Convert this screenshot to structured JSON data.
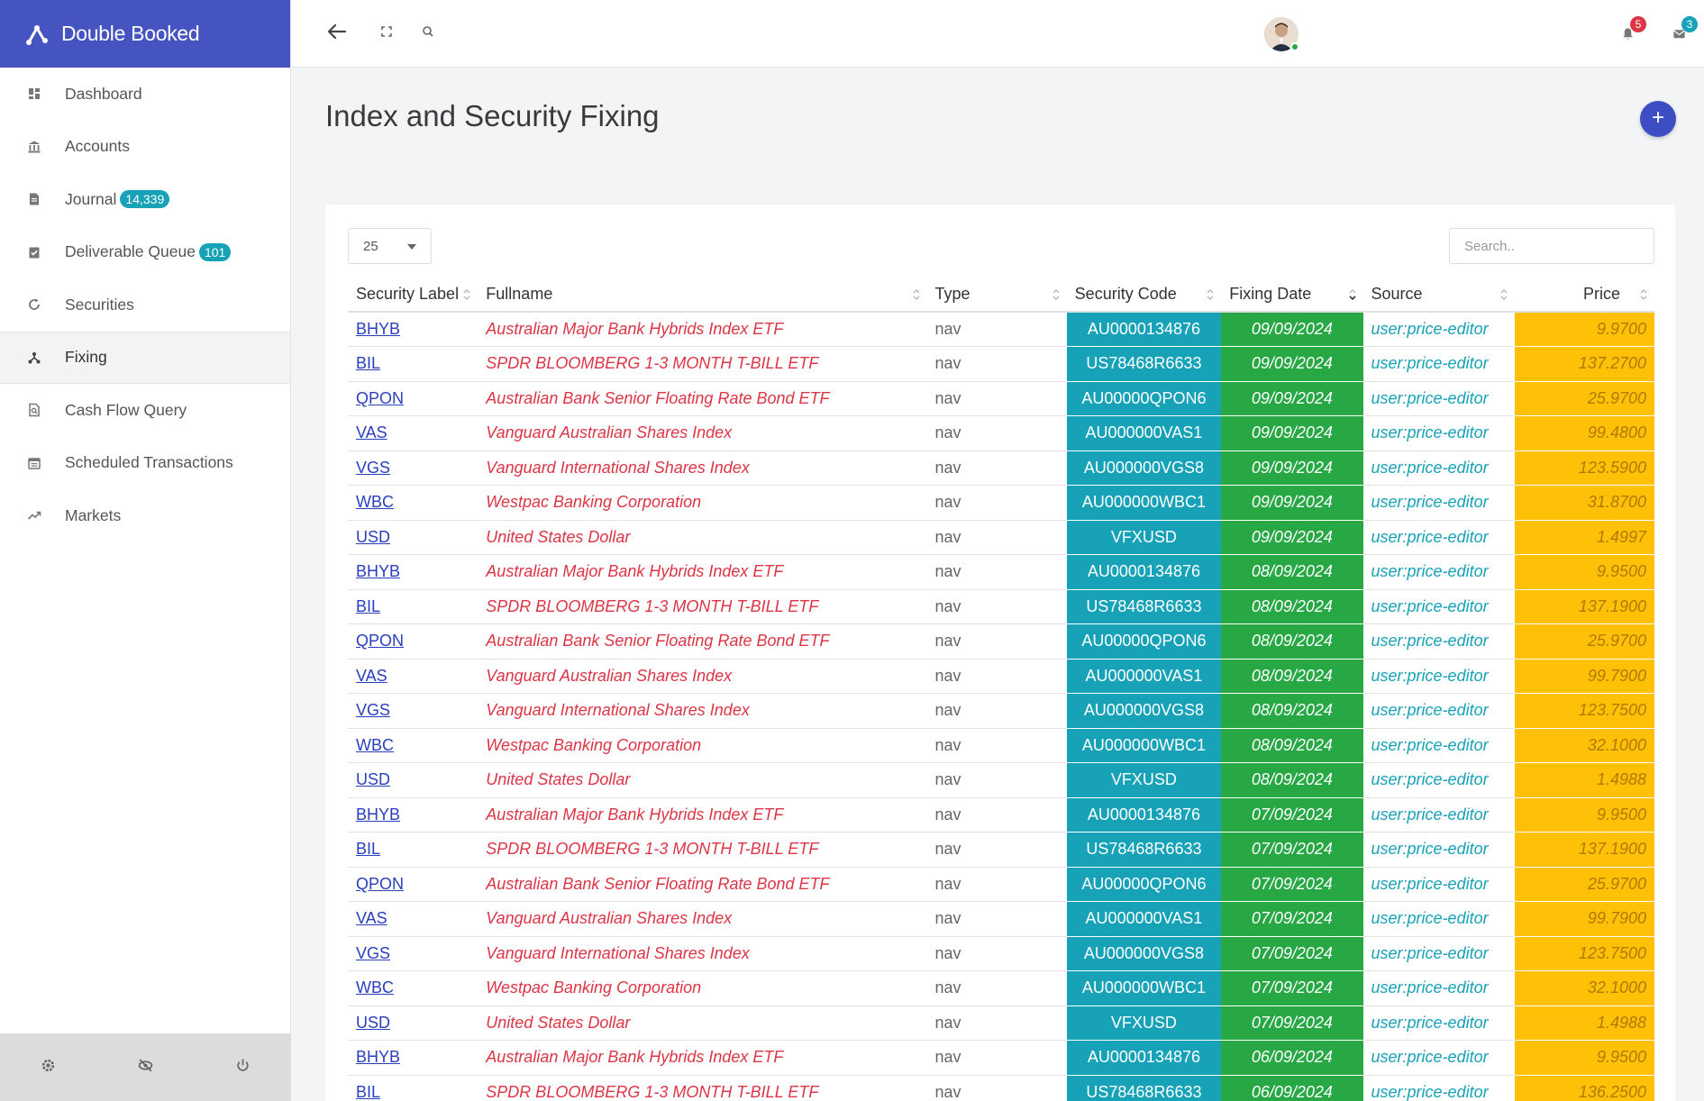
{
  "app": {
    "title": "Double Booked"
  },
  "sidebar": {
    "items": [
      {
        "label": "Dashboard",
        "icon": "dashboard-icon"
      },
      {
        "label": "Accounts",
        "icon": "bank-icon"
      },
      {
        "label": "Journal",
        "icon": "document-icon",
        "badge": "14,339"
      },
      {
        "label": "Deliverable Queue",
        "icon": "clipboard-check-icon",
        "badge": "101"
      },
      {
        "label": "Securities",
        "icon": "refresh-icon"
      },
      {
        "label": "Fixing",
        "icon": "fork-icon",
        "active": true
      },
      {
        "label": "Cash Flow Query",
        "icon": "search-document-icon"
      },
      {
        "label": "Scheduled Transactions",
        "icon": "calendar-icon"
      },
      {
        "label": "Markets",
        "icon": "trending-icon"
      }
    ],
    "footer": [
      "gear-icon",
      "eye-slash-icon",
      "power-icon"
    ]
  },
  "topbar": {
    "notifications_count": "5",
    "messages_count": "3",
    "notification_color": "#dc3545",
    "message_color": "#17a2b8"
  },
  "page": {
    "title": "Index and Security Fixing",
    "add_label": "+"
  },
  "table": {
    "page_length": "25",
    "search_placeholder": "Search..",
    "headers": {
      "label": "Security Label",
      "fullname": "Fullname",
      "type": "Type",
      "code": "Security Code",
      "date": "Fixing Date",
      "source": "Source",
      "price": "Price"
    },
    "rows": [
      [
        "BHYB",
        "Australian Major Bank Hybrids Index ETF",
        "nav",
        "AU0000134876",
        "09/09/2024",
        "user:price-editor",
        "9.9700"
      ],
      [
        "BIL",
        "SPDR BLOOMBERG 1-3 MONTH T-BILL ETF",
        "nav",
        "US78468R6633",
        "09/09/2024",
        "user:price-editor",
        "137.2700"
      ],
      [
        "QPON",
        "Australian Bank Senior Floating Rate Bond ETF",
        "nav",
        "AU00000QPON6",
        "09/09/2024",
        "user:price-editor",
        "25.9700"
      ],
      [
        "VAS",
        "Vanguard Australian Shares Index",
        "nav",
        "AU000000VAS1",
        "09/09/2024",
        "user:price-editor",
        "99.4800"
      ],
      [
        "VGS",
        "Vanguard International Shares Index",
        "nav",
        "AU000000VGS8",
        "09/09/2024",
        "user:price-editor",
        "123.5900"
      ],
      [
        "WBC",
        "Westpac Banking Corporation",
        "nav",
        "AU000000WBC1",
        "09/09/2024",
        "user:price-editor",
        "31.8700"
      ],
      [
        "USD",
        "United States Dollar",
        "nav",
        "VFXUSD",
        "09/09/2024",
        "user:price-editor",
        "1.4997"
      ],
      [
        "BHYB",
        "Australian Major Bank Hybrids Index ETF",
        "nav",
        "AU0000134876",
        "08/09/2024",
        "user:price-editor",
        "9.9500"
      ],
      [
        "BIL",
        "SPDR BLOOMBERG 1-3 MONTH T-BILL ETF",
        "nav",
        "US78468R6633",
        "08/09/2024",
        "user:price-editor",
        "137.1900"
      ],
      [
        "QPON",
        "Australian Bank Senior Floating Rate Bond ETF",
        "nav",
        "AU00000QPON6",
        "08/09/2024",
        "user:price-editor",
        "25.9700"
      ],
      [
        "VAS",
        "Vanguard Australian Shares Index",
        "nav",
        "AU000000VAS1",
        "08/09/2024",
        "user:price-editor",
        "99.7900"
      ],
      [
        "VGS",
        "Vanguard International Shares Index",
        "nav",
        "AU000000VGS8",
        "08/09/2024",
        "user:price-editor",
        "123.7500"
      ],
      [
        "WBC",
        "Westpac Banking Corporation",
        "nav",
        "AU000000WBC1",
        "08/09/2024",
        "user:price-editor",
        "32.1000"
      ],
      [
        "USD",
        "United States Dollar",
        "nav",
        "VFXUSD",
        "08/09/2024",
        "user:price-editor",
        "1.4988"
      ],
      [
        "BHYB",
        "Australian Major Bank Hybrids Index ETF",
        "nav",
        "AU0000134876",
        "07/09/2024",
        "user:price-editor",
        "9.9500"
      ],
      [
        "BIL",
        "SPDR BLOOMBERG 1-3 MONTH T-BILL ETF",
        "nav",
        "US78468R6633",
        "07/09/2024",
        "user:price-editor",
        "137.1900"
      ],
      [
        "QPON",
        "Australian Bank Senior Floating Rate Bond ETF",
        "nav",
        "AU00000QPON6",
        "07/09/2024",
        "user:price-editor",
        "25.9700"
      ],
      [
        "VAS",
        "Vanguard Australian Shares Index",
        "nav",
        "AU000000VAS1",
        "07/09/2024",
        "user:price-editor",
        "99.7900"
      ],
      [
        "VGS",
        "Vanguard International Shares Index",
        "nav",
        "AU000000VGS8",
        "07/09/2024",
        "user:price-editor",
        "123.7500"
      ],
      [
        "WBC",
        "Westpac Banking Corporation",
        "nav",
        "AU000000WBC1",
        "07/09/2024",
        "user:price-editor",
        "32.1000"
      ],
      [
        "USD",
        "United States Dollar",
        "nav",
        "VFXUSD",
        "07/09/2024",
        "user:price-editor",
        "1.4988"
      ],
      [
        "BHYB",
        "Australian Major Bank Hybrids Index ETF",
        "nav",
        "AU0000134876",
        "06/09/2024",
        "user:price-editor",
        "9.9500"
      ],
      [
        "BIL",
        "SPDR BLOOMBERG 1-3 MONTH T-BILL ETF",
        "nav",
        "US78468R6633",
        "06/09/2024",
        "user:price-editor",
        "136.2500"
      ]
    ]
  },
  "colors": {
    "brand": "#4554c0",
    "code_cell": "#17a2b8",
    "date_cell": "#28a745",
    "price_cell": "#ffc107",
    "fullname_text": "#dc3545"
  }
}
